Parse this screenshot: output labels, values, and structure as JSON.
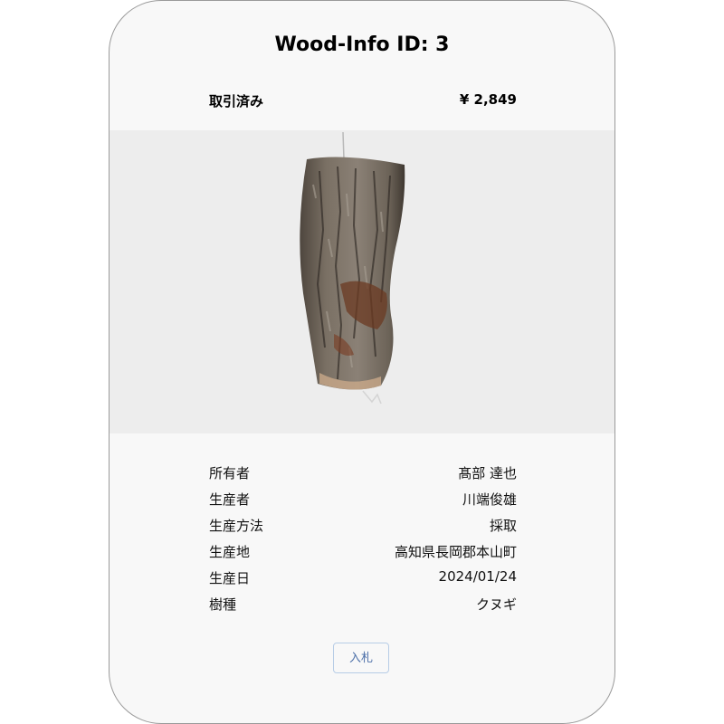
{
  "header": {
    "title": "Wood-Info ID: 3",
    "status": "取引済み",
    "price": "¥ 2,849"
  },
  "details": [
    {
      "label": "所有者",
      "value": "髙部 達也"
    },
    {
      "label": "生産者",
      "value": "川端俊雄"
    },
    {
      "label": "生産方法",
      "value": "採取"
    },
    {
      "label": "生産地",
      "value": "高知県長岡郡本山町"
    },
    {
      "label": "生産日",
      "value": "2024/01/24"
    },
    {
      "label": "樹種",
      "value": "クヌギ"
    }
  ],
  "actions": {
    "bid_label": "入札"
  },
  "colors": {
    "card_bg": "#f8f8f8",
    "image_bg": "#ededed",
    "button_text": "#4c6fa8",
    "button_border": "#b7cde6"
  },
  "icons": {
    "photo": "wood-log-image"
  }
}
